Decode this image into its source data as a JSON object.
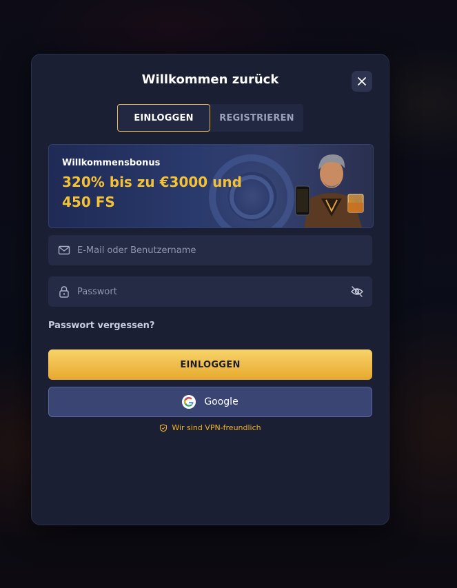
{
  "modal": {
    "title": "Willkommen zurück",
    "close_icon": "close-icon"
  },
  "tabs": [
    {
      "label": "EINLOGGEN",
      "active": true
    },
    {
      "label": "REGISTRIEREN",
      "active": false
    }
  ],
  "banner": {
    "label": "Willkommensbonus",
    "offer": "320% bis zu €3000 und 450 FS",
    "accent_color": "#f5c236"
  },
  "form": {
    "username_placeholder": "E-Mail oder Benutzername",
    "username_value": "",
    "username_icon": "envelope-icon",
    "password_placeholder": "Passwort",
    "password_value": "",
    "password_icon": "lock-icon",
    "visibility_icon": "eye-off-icon",
    "forgot_label": "Passwort vergessen?"
  },
  "buttons": {
    "login_label": "EINLOGGEN",
    "google_label": "Google",
    "login_color": "#f5c236"
  },
  "vpn_note": "Wir sind VPN-freundlich"
}
